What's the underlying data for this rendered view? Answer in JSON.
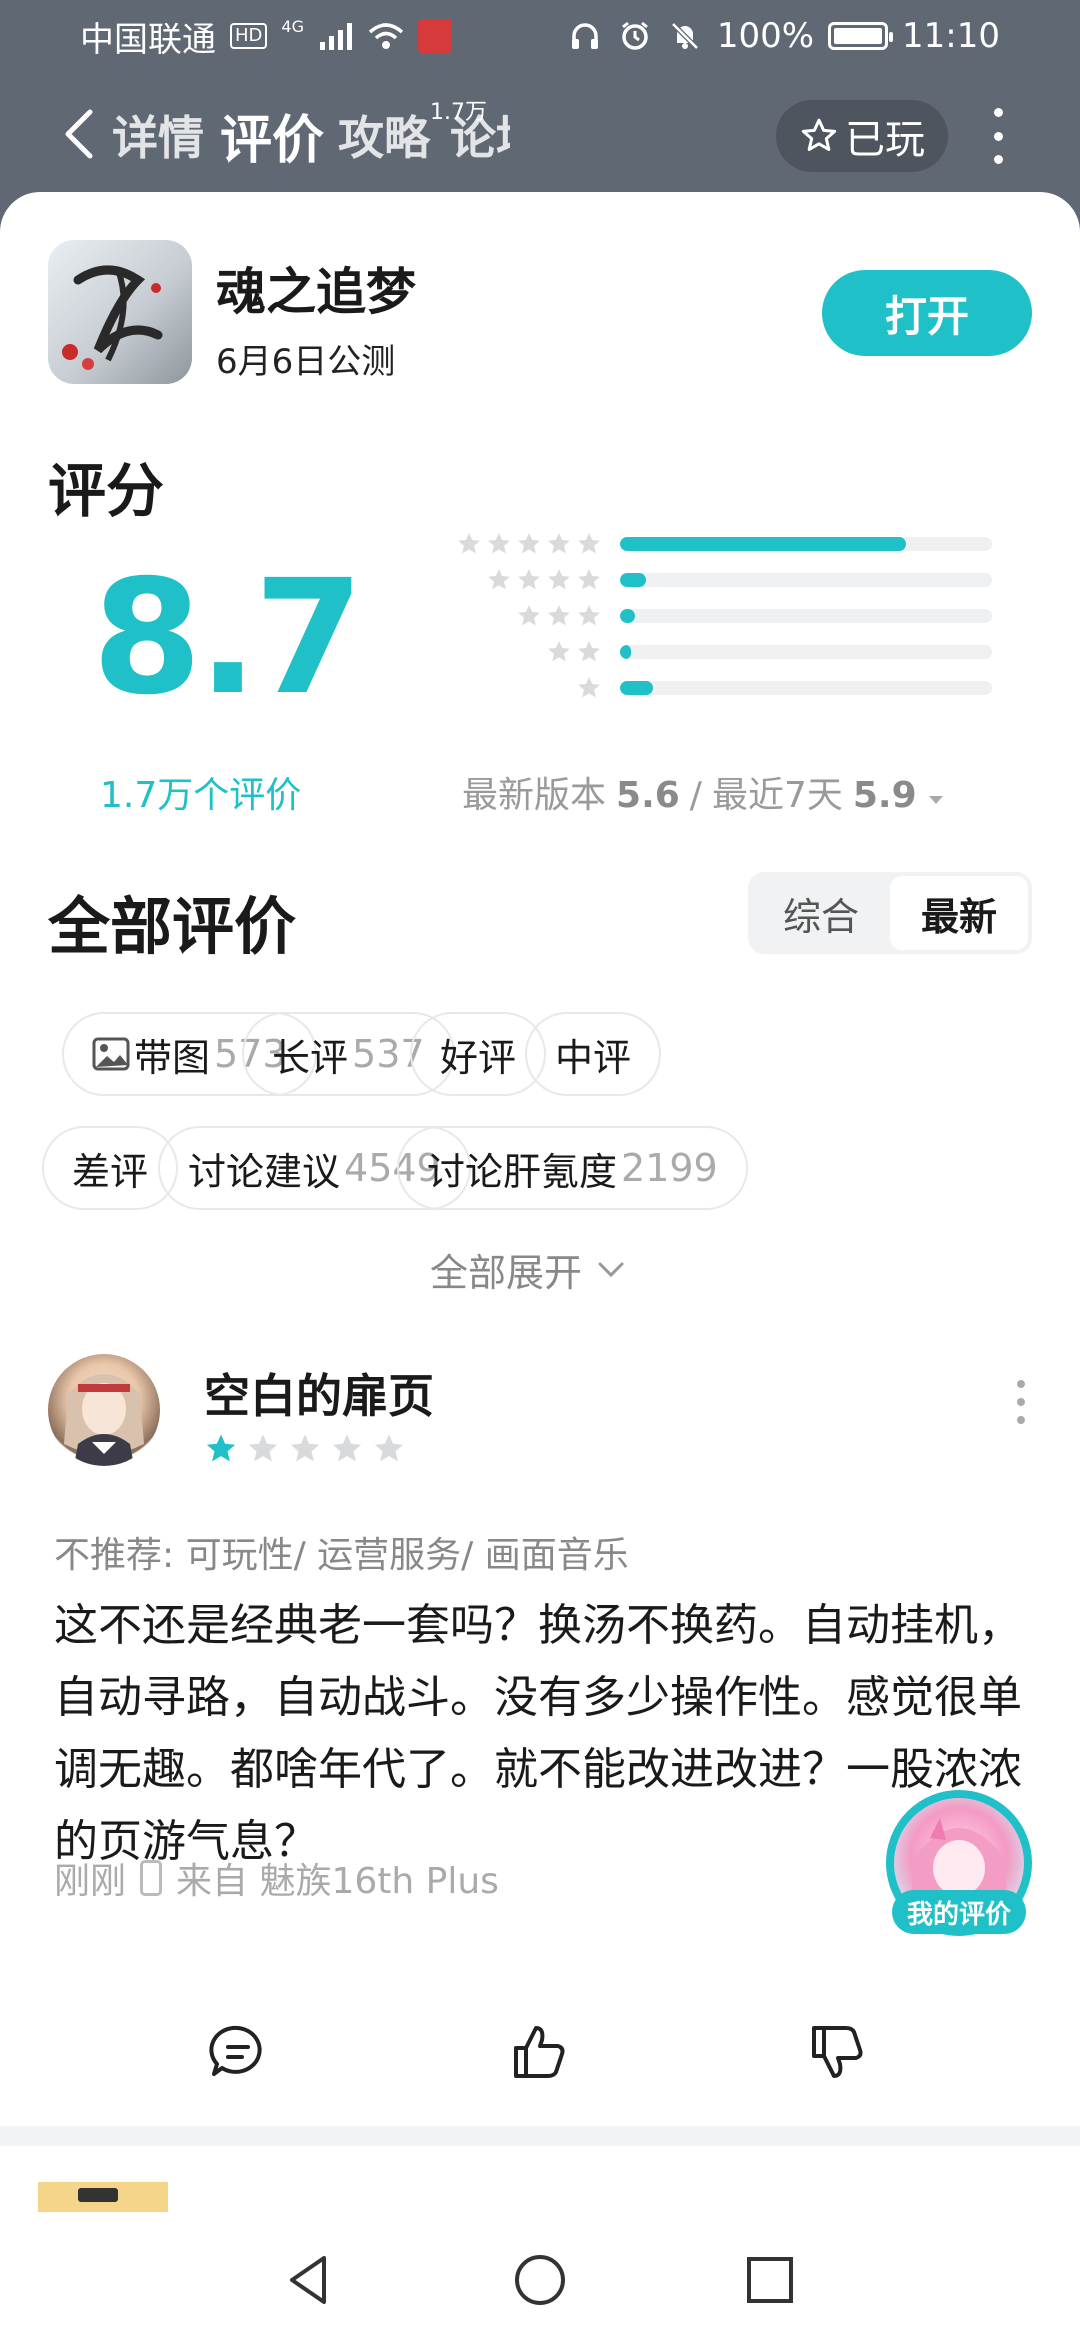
{
  "status_bar": {
    "carrier": "中国联通",
    "hd": "HD",
    "network": "4G",
    "battery": "100%",
    "time": "11:10"
  },
  "nav": {
    "tabs": [
      {
        "label": "详情"
      },
      {
        "label": "评价",
        "badge": "1.7万"
      },
      {
        "label": "攻略"
      },
      {
        "label": "论坛"
      }
    ],
    "played_label": "已玩"
  },
  "game": {
    "name": "魂之追梦",
    "subtitle": "6月6日公测",
    "open_label": "打开"
  },
  "rating": {
    "title": "评分",
    "score": "8.7",
    "count_label": "1.7万个评价",
    "distribution": [
      {
        "stars": 5,
        "fraction": 0.77
      },
      {
        "stars": 4,
        "fraction": 0.07
      },
      {
        "stars": 3,
        "fraction": 0.04
      },
      {
        "stars": 2,
        "fraction": 0.03
      },
      {
        "stars": 1,
        "fraction": 0.09
      }
    ],
    "version_label": "最新版本",
    "version_score": "5.6",
    "separator": "/",
    "recent_label": "最近7天",
    "recent_score": "5.9"
  },
  "reviews_section": {
    "title": "全部评价",
    "sort_options": [
      "综合",
      "最新"
    ],
    "sort_selected": "最新",
    "chips": [
      {
        "label": "带图",
        "count": "573"
      },
      {
        "label": "长评",
        "count": "537"
      },
      {
        "label": "好评",
        "count": ""
      },
      {
        "label": "中评",
        "count": ""
      },
      {
        "label": "差评",
        "count": ""
      },
      {
        "label": "讨论建议",
        "count": "4549"
      },
      {
        "label": "讨论肝氪度",
        "count": "2199"
      }
    ],
    "expand_label": "全部展开"
  },
  "review": {
    "user_name": "空白的扉页",
    "stars": 1,
    "tags": "不推荐: 可玩性/ 运营服务/ 画面音乐",
    "body": "这不还是经典老一套吗？换汤不换药。自动挂机，自动寻路，自动战斗。没有多少操作性。感觉很单调无趣。都啥年代了。就不能改进改进？一股浓浓的页游气息？",
    "time": "刚刚",
    "device": "来自 魅族16th Plus"
  },
  "my_review_label": "我的评价",
  "colors": {
    "accent": "#1fc0c7",
    "header_bg": "#606874",
    "star_active": "#1fc0c7",
    "star_inactive": "#d8dadc"
  }
}
